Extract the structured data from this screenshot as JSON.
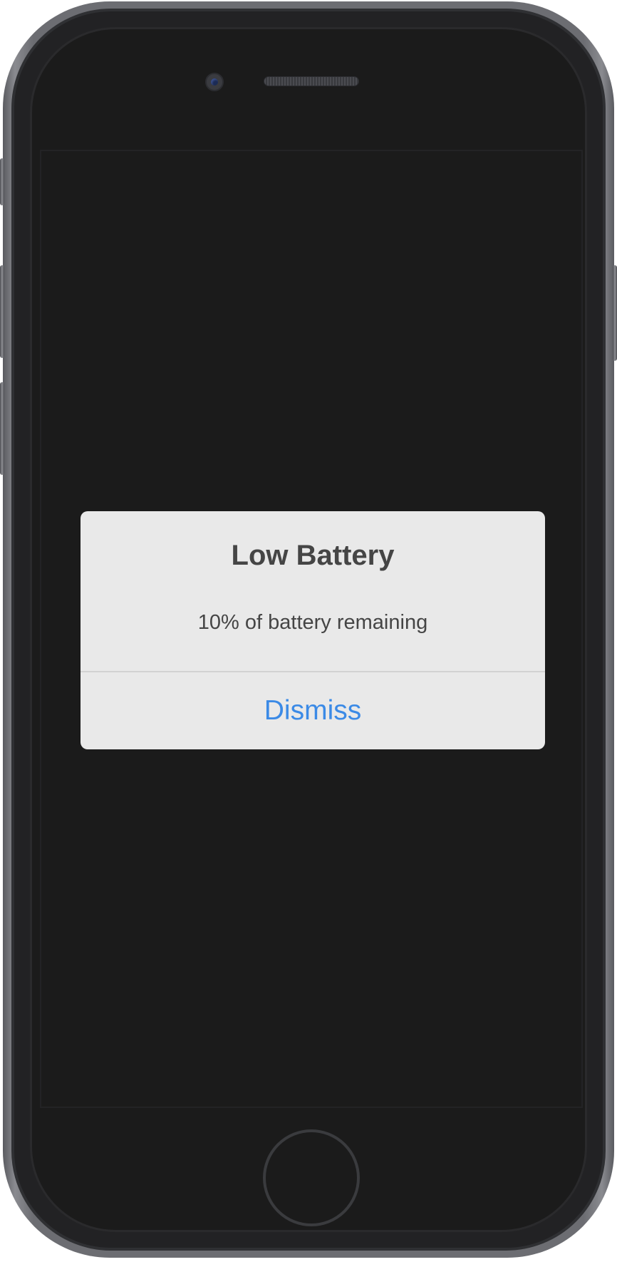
{
  "alert": {
    "title": "Low Battery",
    "message": "10% of battery remaining",
    "dismiss_label": "Dismiss"
  },
  "colors": {
    "screen_background": "#1b1b1b",
    "alert_background": "#e9e9e9",
    "text": "#454545",
    "accent": "#3b8ae6"
  },
  "icons": {
    "camera": "camera-icon",
    "speaker": "speaker-grille-icon",
    "home": "home-button-icon"
  }
}
